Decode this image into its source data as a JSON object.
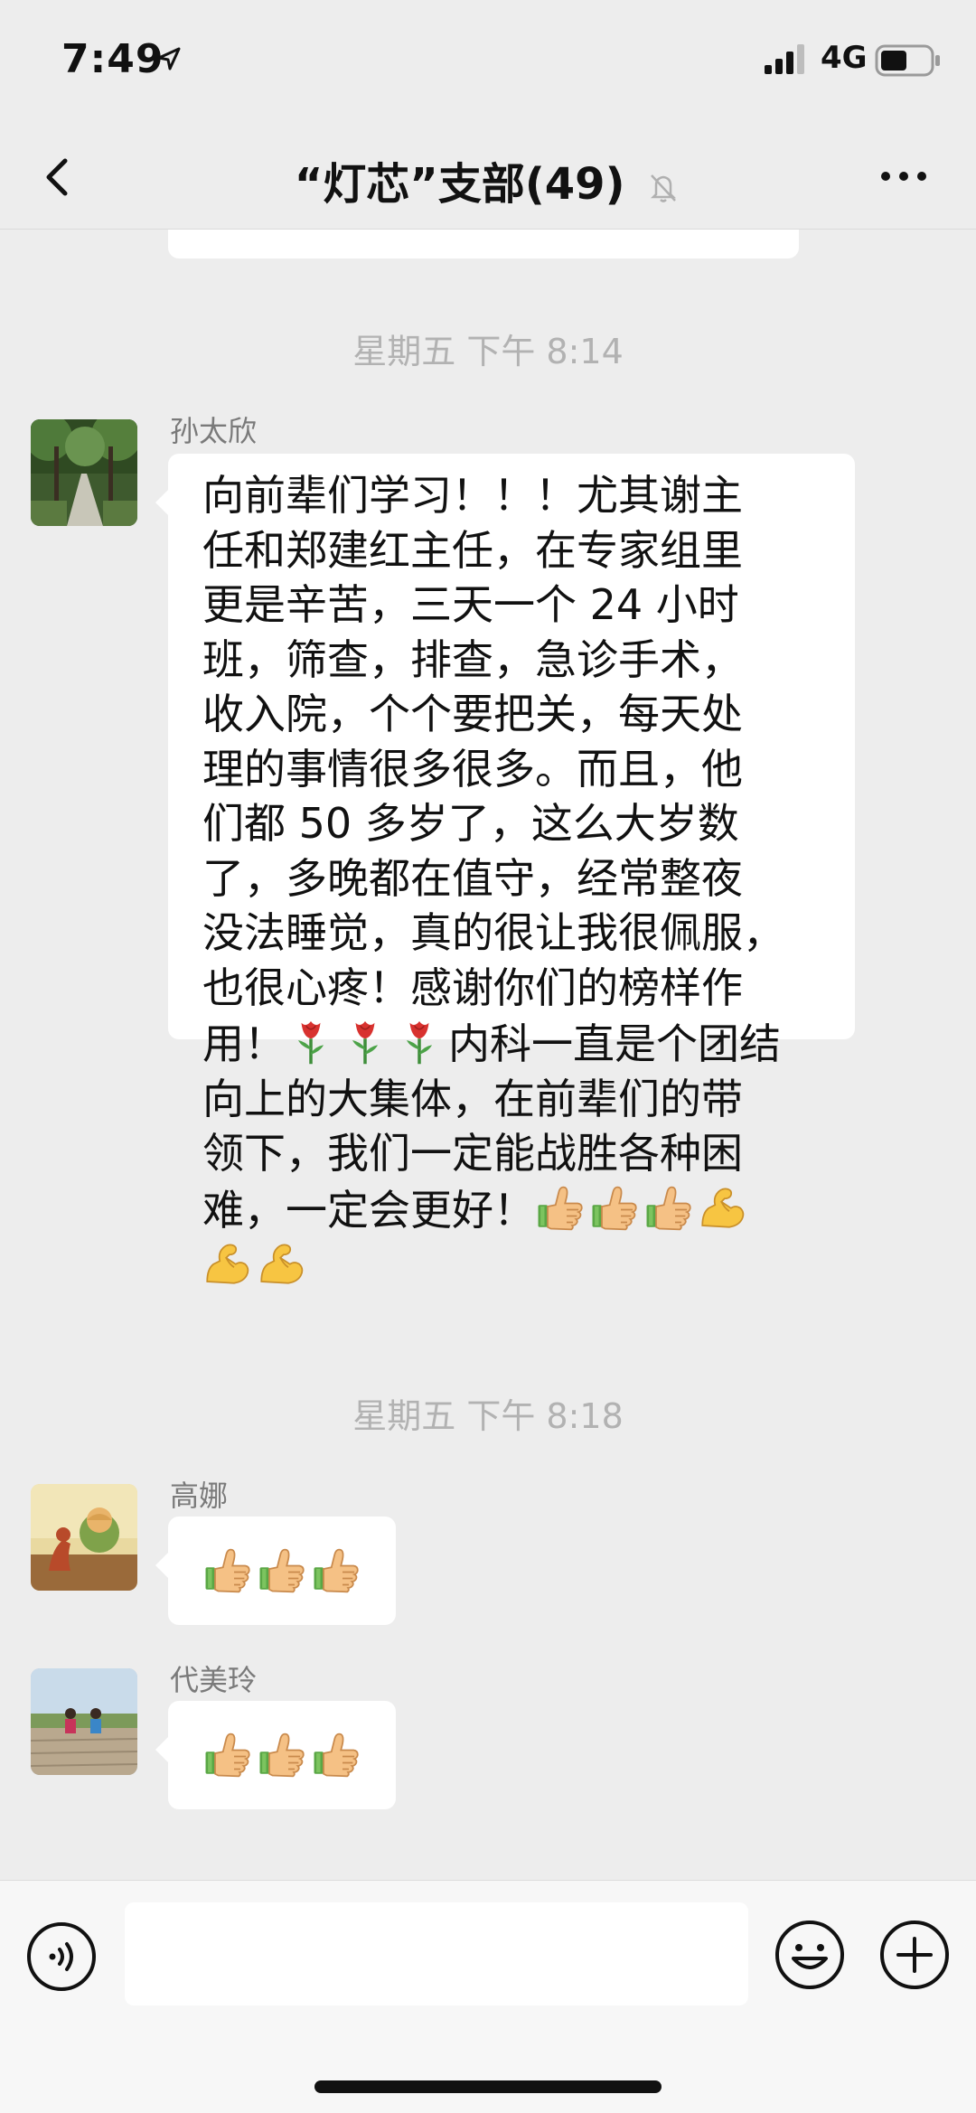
{
  "status_bar": {
    "time": "7:49",
    "network": "4G"
  },
  "header": {
    "title": "“灯芯”支部(49)"
  },
  "messages": [
    {
      "timestamp": "星期五 下午 8:14",
      "sender": "孙太欣",
      "lines": [
        "向前辈们学习！！！尤其谢主",
        "任和郑建红主任，在专家组里",
        "更是辛苦，三天一个 24 小时",
        "班，筛查，排查，急诊手术，",
        "收入院，个个要把关，每天处",
        "理的事情很多很多。而且，他",
        "们都 50 多岁了，这么大岁数",
        "了，多晚都在值守，经常整夜",
        "没法睡觉，真的很让我很佩服，",
        "也很心疼！感谢你们的榜样作"
      ],
      "line11_a": "用！",
      "line11_b": "内科一直是个团结",
      "line12": "向上的大集体，在前辈们的带",
      "line13": "领下，我们一定能战胜各种困",
      "line14": "难，一定会更好！"
    },
    {
      "timestamp": "星期五 下午 8:18",
      "sender": "高娜"
    },
    {
      "sender": "代美玲"
    }
  ],
  "icons": {
    "rose": "rose-emoji",
    "thumbs_up": "thumbs-up-emoji",
    "flexed_biceps": "flexed-biceps-emoji"
  },
  "colors": {
    "background": "#EDEDED",
    "bubble": "#FFFFFF",
    "timestamp": "#B2B2B2",
    "sender": "#7A7A7A"
  }
}
